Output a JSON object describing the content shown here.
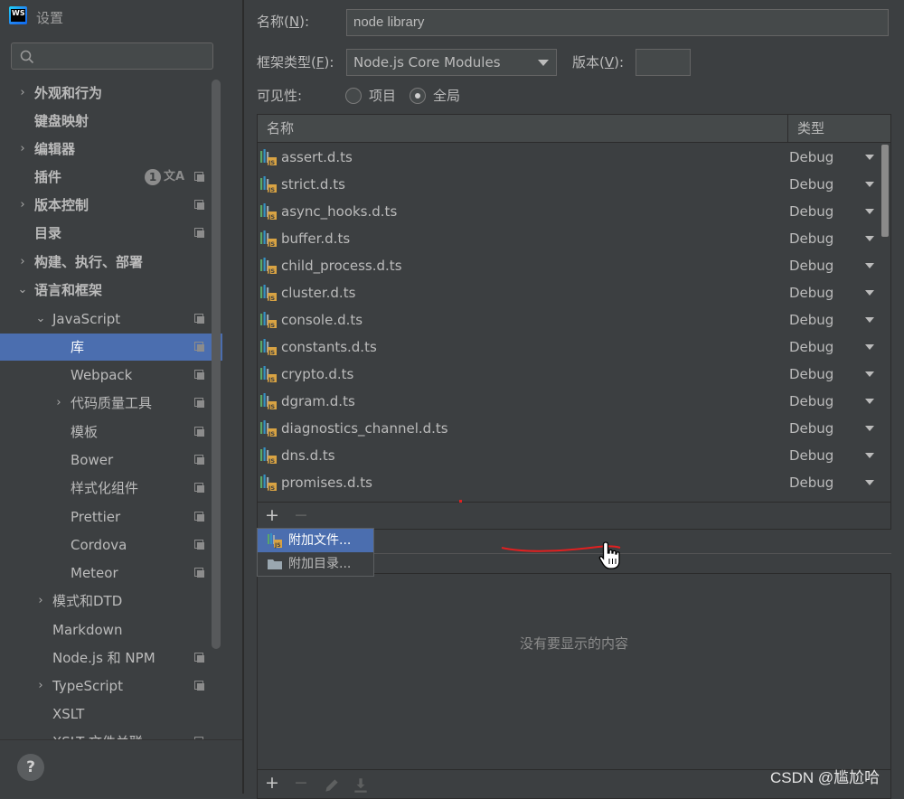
{
  "window": {
    "title": "设置"
  },
  "search": {
    "placeholder": ""
  },
  "sidebar": {
    "items": [
      {
        "label": "外观和行为",
        "arrow": "›",
        "bold": true
      },
      {
        "label": "键盘映射",
        "bold": true
      },
      {
        "label": "编辑器",
        "arrow": "›",
        "bold": true
      },
      {
        "label": "插件",
        "bold": true,
        "badge": "1"
      },
      {
        "label": "版本控制",
        "arrow": "›",
        "bold": true
      },
      {
        "label": "目录",
        "bold": true
      },
      {
        "label": "构建、执行、部署",
        "arrow": "›",
        "bold": true
      },
      {
        "label": "语言和框架",
        "arrow": "⌄",
        "bold": true
      },
      {
        "label": "JavaScript",
        "arrow": "⌄"
      },
      {
        "label": "库",
        "selected": true
      },
      {
        "label": "Webpack"
      },
      {
        "label": "代码质量工具",
        "arrow": "›"
      },
      {
        "label": "模板"
      },
      {
        "label": "Bower"
      },
      {
        "label": "样式化组件"
      },
      {
        "label": "Prettier"
      },
      {
        "label": "Cordova"
      },
      {
        "label": "Meteor"
      },
      {
        "label": "模式和DTD",
        "arrow": "›"
      },
      {
        "label": "Markdown"
      },
      {
        "label": "Node.js 和 NPM"
      },
      {
        "label": "TypeScript",
        "arrow": "›"
      },
      {
        "label": "XSLT"
      },
      {
        "label": "XSLT 文件关联"
      }
    ],
    "translate_glyph": "文A",
    "help_label": "?"
  },
  "form": {
    "name_label_prefix": "名称(",
    "name_label_mnemonic": "N",
    "name_label_suffix": "):",
    "name_value": "node library",
    "framework_label_prefix": "框架类型(",
    "framework_label_mnemonic": "F",
    "framework_label_suffix": "):",
    "framework_value": "Node.js Core Modules",
    "version_label_prefix": "版本(",
    "version_label_mnemonic": "V",
    "version_label_suffix": "):",
    "version_value": "",
    "visibility_label": "可见性:",
    "visibility_options": [
      {
        "label": "项目",
        "checked": false
      },
      {
        "label": "全局",
        "checked": true
      }
    ]
  },
  "table": {
    "columns": [
      "名称",
      "类型"
    ],
    "rows": [
      {
        "name": "assert.d.ts",
        "type": "Debug"
      },
      {
        "name": "strict.d.ts",
        "type": "Debug"
      },
      {
        "name": "async_hooks.d.ts",
        "type": "Debug"
      },
      {
        "name": "buffer.d.ts",
        "type": "Debug"
      },
      {
        "name": "child_process.d.ts",
        "type": "Debug"
      },
      {
        "name": "cluster.d.ts",
        "type": "Debug"
      },
      {
        "name": "console.d.ts",
        "type": "Debug"
      },
      {
        "name": "constants.d.ts",
        "type": "Debug"
      },
      {
        "name": "crypto.d.ts",
        "type": "Debug"
      },
      {
        "name": "dgram.d.ts",
        "type": "Debug"
      },
      {
        "name": "diagnostics_channel.d.ts",
        "type": "Debug"
      },
      {
        "name": "dns.d.ts",
        "type": "Debug"
      },
      {
        "name": "promises.d.ts",
        "type": "Debug"
      }
    ],
    "toolbar": {
      "add": "+",
      "remove": "−"
    }
  },
  "popup": {
    "items": [
      {
        "label": "附加文件...",
        "active": true
      },
      {
        "label": "附加目录...",
        "active": false
      }
    ]
  },
  "lower_panel": {
    "empty_text": "没有要显示的内容",
    "toolbar": {
      "add": "+",
      "remove": "−"
    }
  },
  "watermark": "CSDN @尴尬哈",
  "colors": {
    "background": "#3c3f41",
    "selection": "#4b6eaf",
    "text": "#bbbbbb",
    "annotation_red": "#e02020"
  }
}
